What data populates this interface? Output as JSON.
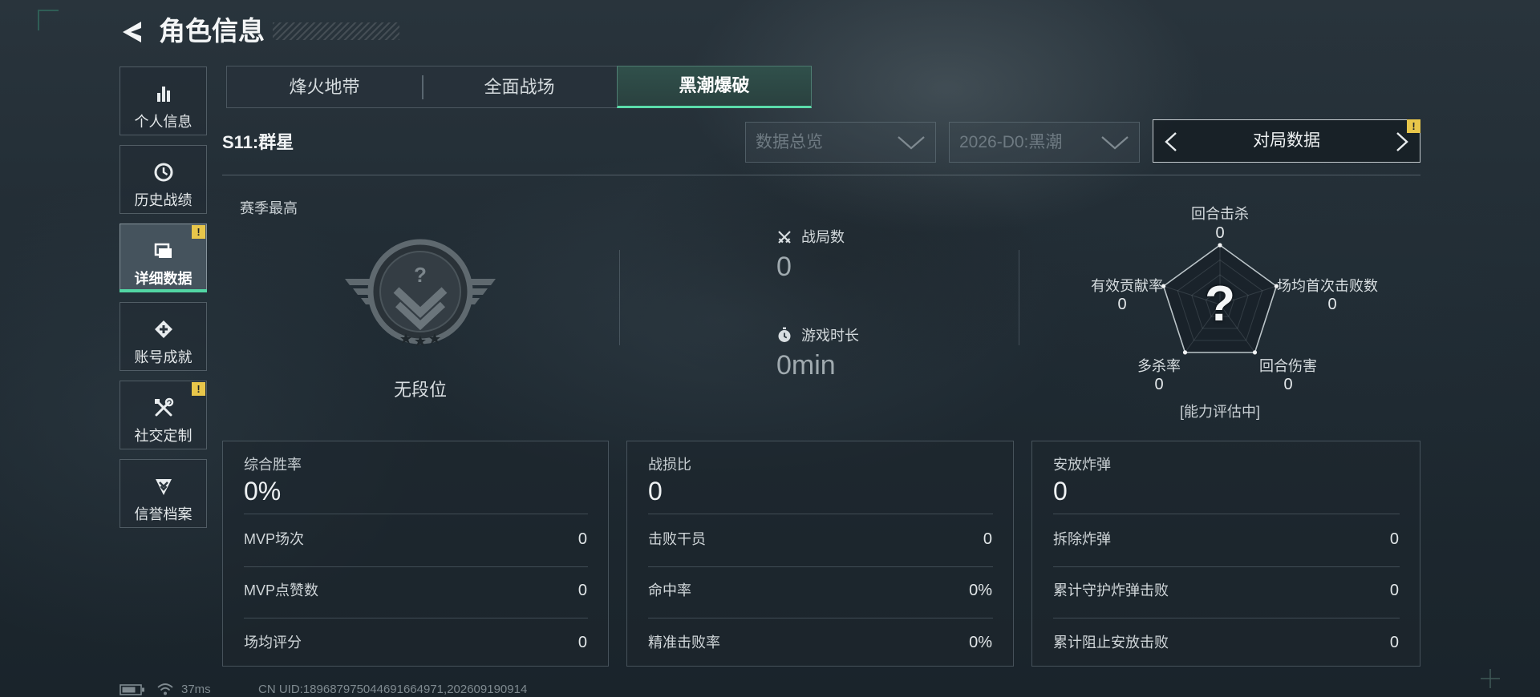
{
  "header": {
    "title": "角色信息",
    "back_icon": "chevron-left-icon"
  },
  "sidebar": {
    "items": [
      {
        "label": "个人信息",
        "icon": "bar-chart-icon",
        "active": false,
        "badge": null
      },
      {
        "label": "历史战绩",
        "icon": "clock-icon",
        "active": false,
        "badge": null
      },
      {
        "label": "详细数据",
        "icon": "folder-icon",
        "active": true,
        "badge": "!"
      },
      {
        "label": "账号成就",
        "icon": "medal-icon",
        "active": false,
        "badge": null
      },
      {
        "label": "社交定制",
        "icon": "wrench-icon",
        "active": false,
        "badge": "!"
      },
      {
        "label": "信誉档案",
        "icon": "credit-badge-icon",
        "active": false,
        "badge": null
      }
    ]
  },
  "tabs": [
    {
      "label": "烽火地带",
      "active": false
    },
    {
      "label": "全面战场",
      "active": false
    },
    {
      "label": "黑潮爆破",
      "active": true
    }
  ],
  "season_label": "S11:群星",
  "filters": {
    "overview": {
      "value": "数据总览",
      "icon": "chevron-down-icon"
    },
    "season": {
      "value": "2026-D0:黑潮",
      "icon": "chevron-down-icon"
    },
    "data_type": {
      "value": "对局数据",
      "badge": "!",
      "prev_icon": "chevron-left-icon",
      "next_icon": "chevron-right-icon"
    }
  },
  "rank": {
    "heading": "赛季最高",
    "emblem_mark": "?",
    "tier": "无段位",
    "icon": "rank-emblem-icon"
  },
  "summary": {
    "matches": {
      "label": "战局数",
      "value": "0",
      "icon": "crossed-swords-icon"
    },
    "playtime": {
      "label": "游戏时长",
      "value": "0min",
      "icon": "stopwatch-icon"
    }
  },
  "radar": {
    "center_mark": "?",
    "status": "[能力评估中]",
    "axes": [
      {
        "label": "回合击杀",
        "value": "0"
      },
      {
        "label": "场均首次击败数",
        "value": "0"
      },
      {
        "label": "回合伤害",
        "value": "0"
      },
      {
        "label": "多杀率",
        "value": "0"
      },
      {
        "label": "有效贡献率",
        "value": "0"
      }
    ]
  },
  "panels": [
    {
      "title": "综合胜率",
      "value": "0%",
      "rows": [
        {
          "label": "MVP场次",
          "value": "0"
        },
        {
          "label": "MVP点赞数",
          "value": "0"
        },
        {
          "label": "场均评分",
          "value": "0"
        }
      ]
    },
    {
      "title": "战损比",
      "value": "0",
      "rows": [
        {
          "label": "击败干员",
          "value": "0"
        },
        {
          "label": "命中率",
          "value": "0%"
        },
        {
          "label": "精准击败率",
          "value": "0%"
        }
      ]
    },
    {
      "title": "安放炸弹",
      "value": "0",
      "rows": [
        {
          "label": "拆除炸弹",
          "value": "0"
        },
        {
          "label": "累计守护炸弹击败",
          "value": "0"
        },
        {
          "label": "累计阻止安放击败",
          "value": "0"
        }
      ]
    }
  ],
  "status_bar": {
    "battery_icon": "battery-icon",
    "wifi_icon": "wifi-icon",
    "latency": "37ms",
    "uid": "CN UID:189687975044691664971,202609190914"
  },
  "colors": {
    "accent": "#52d6a4",
    "badge": "#e8c64a",
    "background": "#1f2a32",
    "text": "#d3d9dc",
    "muted": "#6e7a82"
  }
}
